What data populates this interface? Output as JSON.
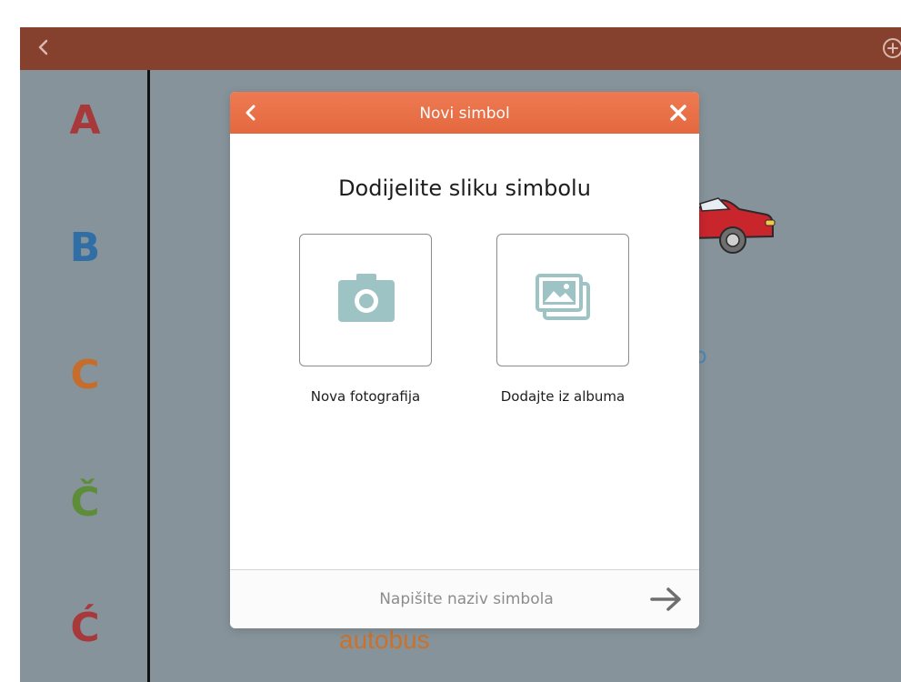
{
  "sidebar": {
    "letters": [
      {
        "char": "A",
        "color": "#a8393a"
      },
      {
        "char": "B",
        "color": "#2f6fa6"
      },
      {
        "char": "C",
        "color": "#c66d2c"
      },
      {
        "char": "Č",
        "color": "#5e8d3a"
      },
      {
        "char": "Ć",
        "color": "#a8393a"
      }
    ]
  },
  "background": {
    "word": "autobus",
    "partial_text": "o",
    "car_icon": "red-car-icon"
  },
  "modal": {
    "title": "Novi simbol",
    "heading": "Dodijelite sliku simbolu",
    "options": [
      {
        "label": "Nova fotografija",
        "icon": "camera-icon"
      },
      {
        "label": "Dodajte iz albuma",
        "icon": "photo-album-icon"
      }
    ],
    "name_placeholder": "Napišite naziv simbola"
  },
  "colors": {
    "topbar": "#86402e",
    "modal_header": "#e86f45",
    "icon_tint": "#9ec3c4",
    "backdrop": "#86939a"
  }
}
